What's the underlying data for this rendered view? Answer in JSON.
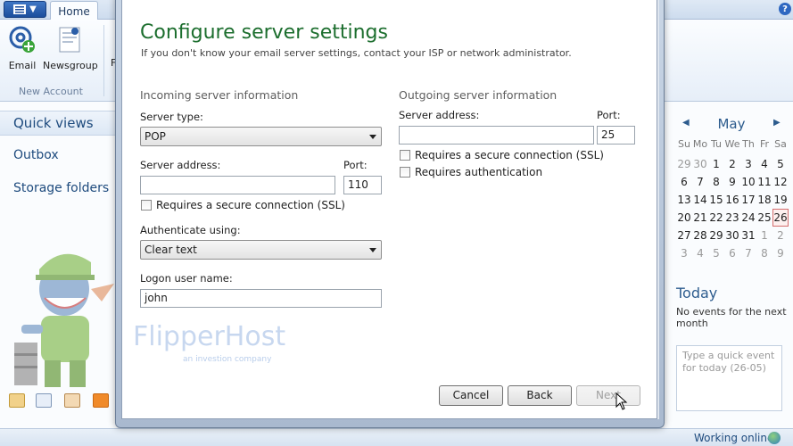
{
  "ribbon": {
    "home_tab": "Home",
    "email_label": "Email",
    "newsgroup_label": "Newsgroup",
    "cut_label": "F",
    "group_label": "New Account"
  },
  "nav": {
    "quick_views": "Quick views",
    "outbox": "Outbox",
    "storage_folders": "Storage folders"
  },
  "calendar": {
    "month": "May",
    "weekdays": [
      "Su",
      "Mo",
      "Tu",
      "We",
      "Th",
      "Fr",
      "Sa"
    ],
    "weeks": [
      [
        "29",
        "30",
        "1",
        "2",
        "3",
        "4",
        "5"
      ],
      [
        "6",
        "7",
        "8",
        "9",
        "10",
        "11",
        "12"
      ],
      [
        "13",
        "14",
        "15",
        "16",
        "17",
        "18",
        "19"
      ],
      [
        "20",
        "21",
        "22",
        "23",
        "24",
        "25",
        "26"
      ],
      [
        "27",
        "28",
        "29",
        "30",
        "31",
        "1",
        "2"
      ],
      [
        "3",
        "4",
        "5",
        "6",
        "7",
        "8",
        "9"
      ]
    ],
    "today_day": "26"
  },
  "today": {
    "title": "Today",
    "no_events": "No events for the next month",
    "quick_event_placeholder": "Type a quick event for today (26-05)"
  },
  "status": {
    "text": "Working online"
  },
  "dialog": {
    "title": "Configure server settings",
    "subtitle": "If you don't know your email server settings, contact your ISP or network administrator.",
    "incoming": {
      "section": "Incoming server information",
      "server_type_label": "Server type:",
      "server_type_value": "POP",
      "server_address_label": "Server address:",
      "server_address_value": "",
      "port_label": "Port:",
      "port_value": "110",
      "ssl_label": "Requires a secure connection (SSL)",
      "auth_label": "Authenticate using:",
      "auth_value": "Clear text",
      "logon_label": "Logon user name:",
      "logon_value": "john"
    },
    "outgoing": {
      "section": "Outgoing server information",
      "server_address_label": "Server address:",
      "server_address_value": "",
      "port_label": "Port:",
      "port_value": "25",
      "ssl_label": "Requires a secure connection (SSL)",
      "auth_required_label": "Requires authentication"
    },
    "buttons": {
      "cancel": "Cancel",
      "back": "Back",
      "next": "Next"
    },
    "watermark": "FlipperHost",
    "watermark_sub": "an investion company"
  }
}
